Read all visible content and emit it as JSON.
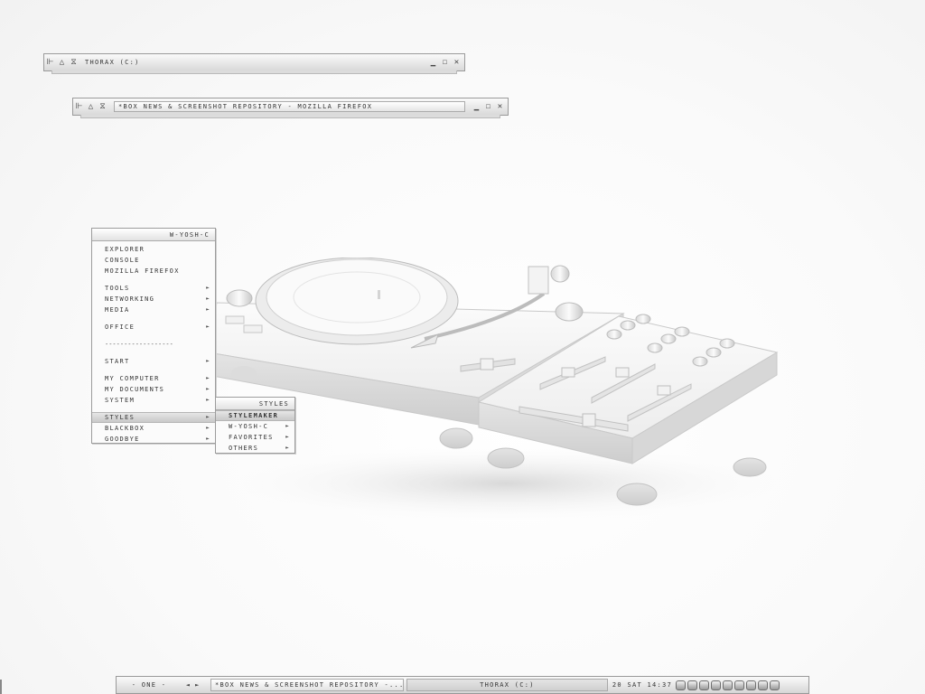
{
  "windows": [
    {
      "title": "THORAX (C:)"
    },
    {
      "title": "*BOX NEWS & SCREENSHOT REPOSITORY - MOZILLA FIREFOX"
    }
  ],
  "root_menu": {
    "title": "W-YOSH-C",
    "items": [
      {
        "label": "EXPLORER",
        "submenu": false
      },
      {
        "label": "CONSOLE",
        "submenu": false
      },
      {
        "label": "MOZILLA FIREFOX",
        "submenu": false
      },
      {
        "label": "TOOLS",
        "submenu": true
      },
      {
        "label": "NETWORKING",
        "submenu": true
      },
      {
        "label": "MEDIA",
        "submenu": true
      },
      {
        "label": "OFFICE",
        "submenu": true
      },
      {
        "label": "------------------",
        "submenu": false
      },
      {
        "label": "START",
        "submenu": true
      },
      {
        "label": "MY COMPUTER",
        "submenu": true
      },
      {
        "label": "MY DOCUMENTS",
        "submenu": true
      },
      {
        "label": "SYSTEM",
        "submenu": true
      },
      {
        "label": "STYLES",
        "submenu": true
      },
      {
        "label": "BLACKBOX",
        "submenu": true
      },
      {
        "label": "GOODBYE",
        "submenu": true
      }
    ]
  },
  "styles_menu": {
    "title": "STYLES",
    "items": [
      {
        "label": "STYLEMAKER",
        "submenu": false
      },
      {
        "label": "W-YOSH-C",
        "submenu": true
      },
      {
        "label": "FAVORITES",
        "submenu": true
      },
      {
        "label": "OTHERS",
        "submenu": true
      }
    ]
  },
  "toolbar": {
    "workspace": "- ONE -",
    "prev": "◄",
    "next": "►",
    "tasks": [
      {
        "label": "*BOX NEWS & SCREENSHOT REPOSITORY -..."
      },
      {
        "label": "THORAX (C:)"
      }
    ],
    "clock": "20 SAT 14:37"
  },
  "tray_icons": [
    "network-icon",
    "volume-icon",
    "monitor-icon",
    "clock-icon",
    "update-icon",
    "shield-icon",
    "graph-icon",
    "music-icon",
    "power-icon"
  ]
}
